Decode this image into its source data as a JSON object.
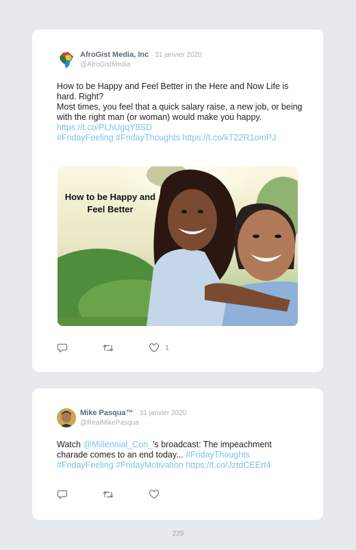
{
  "tweets": [
    {
      "author": "AfroGist Media, Inc",
      "date": "· 31 janvier 2020",
      "handle": "@AfroGistMedia",
      "line1": "How to be Happy and Feel Better in the Here and Now Life is hard. Right?",
      "line2": "Most times, you feel that a quick salary raise, a new job, or being with the right man (or woman) would make you happy.",
      "link1": "https://t.co/PLhUgqY8SD",
      "hashtag1": "#FridayFeeling",
      "hashtag2": "#FridayThoughts",
      "link2": "https://t.co/kT22R1omPJ",
      "media_caption": "How to be Happy and Feel Better",
      "like_count": "1"
    },
    {
      "author": "Mike Pasqua™",
      "date": "· 31 janvier 2020",
      "handle": "@RealMikePasqua",
      "prefix": "Watch ",
      "mention": "@Millennial_Con_",
      "middle": "'s broadcast: The impeachment charade comes to an end today... ",
      "hashtag1": "#FridayThoughts",
      "hashtag2": "#FridayFeeling",
      "hashtag3": "#FridayMotivation",
      "link1": "https://t.co/JztdCEErt4"
    }
  ],
  "page_number": "229",
  "colors": {
    "link": "#7cc2e6",
    "name": "#5b6b78",
    "muted": "#a6b0b8"
  },
  "icons": [
    "reply-icon",
    "retweet-icon",
    "heart-icon"
  ]
}
